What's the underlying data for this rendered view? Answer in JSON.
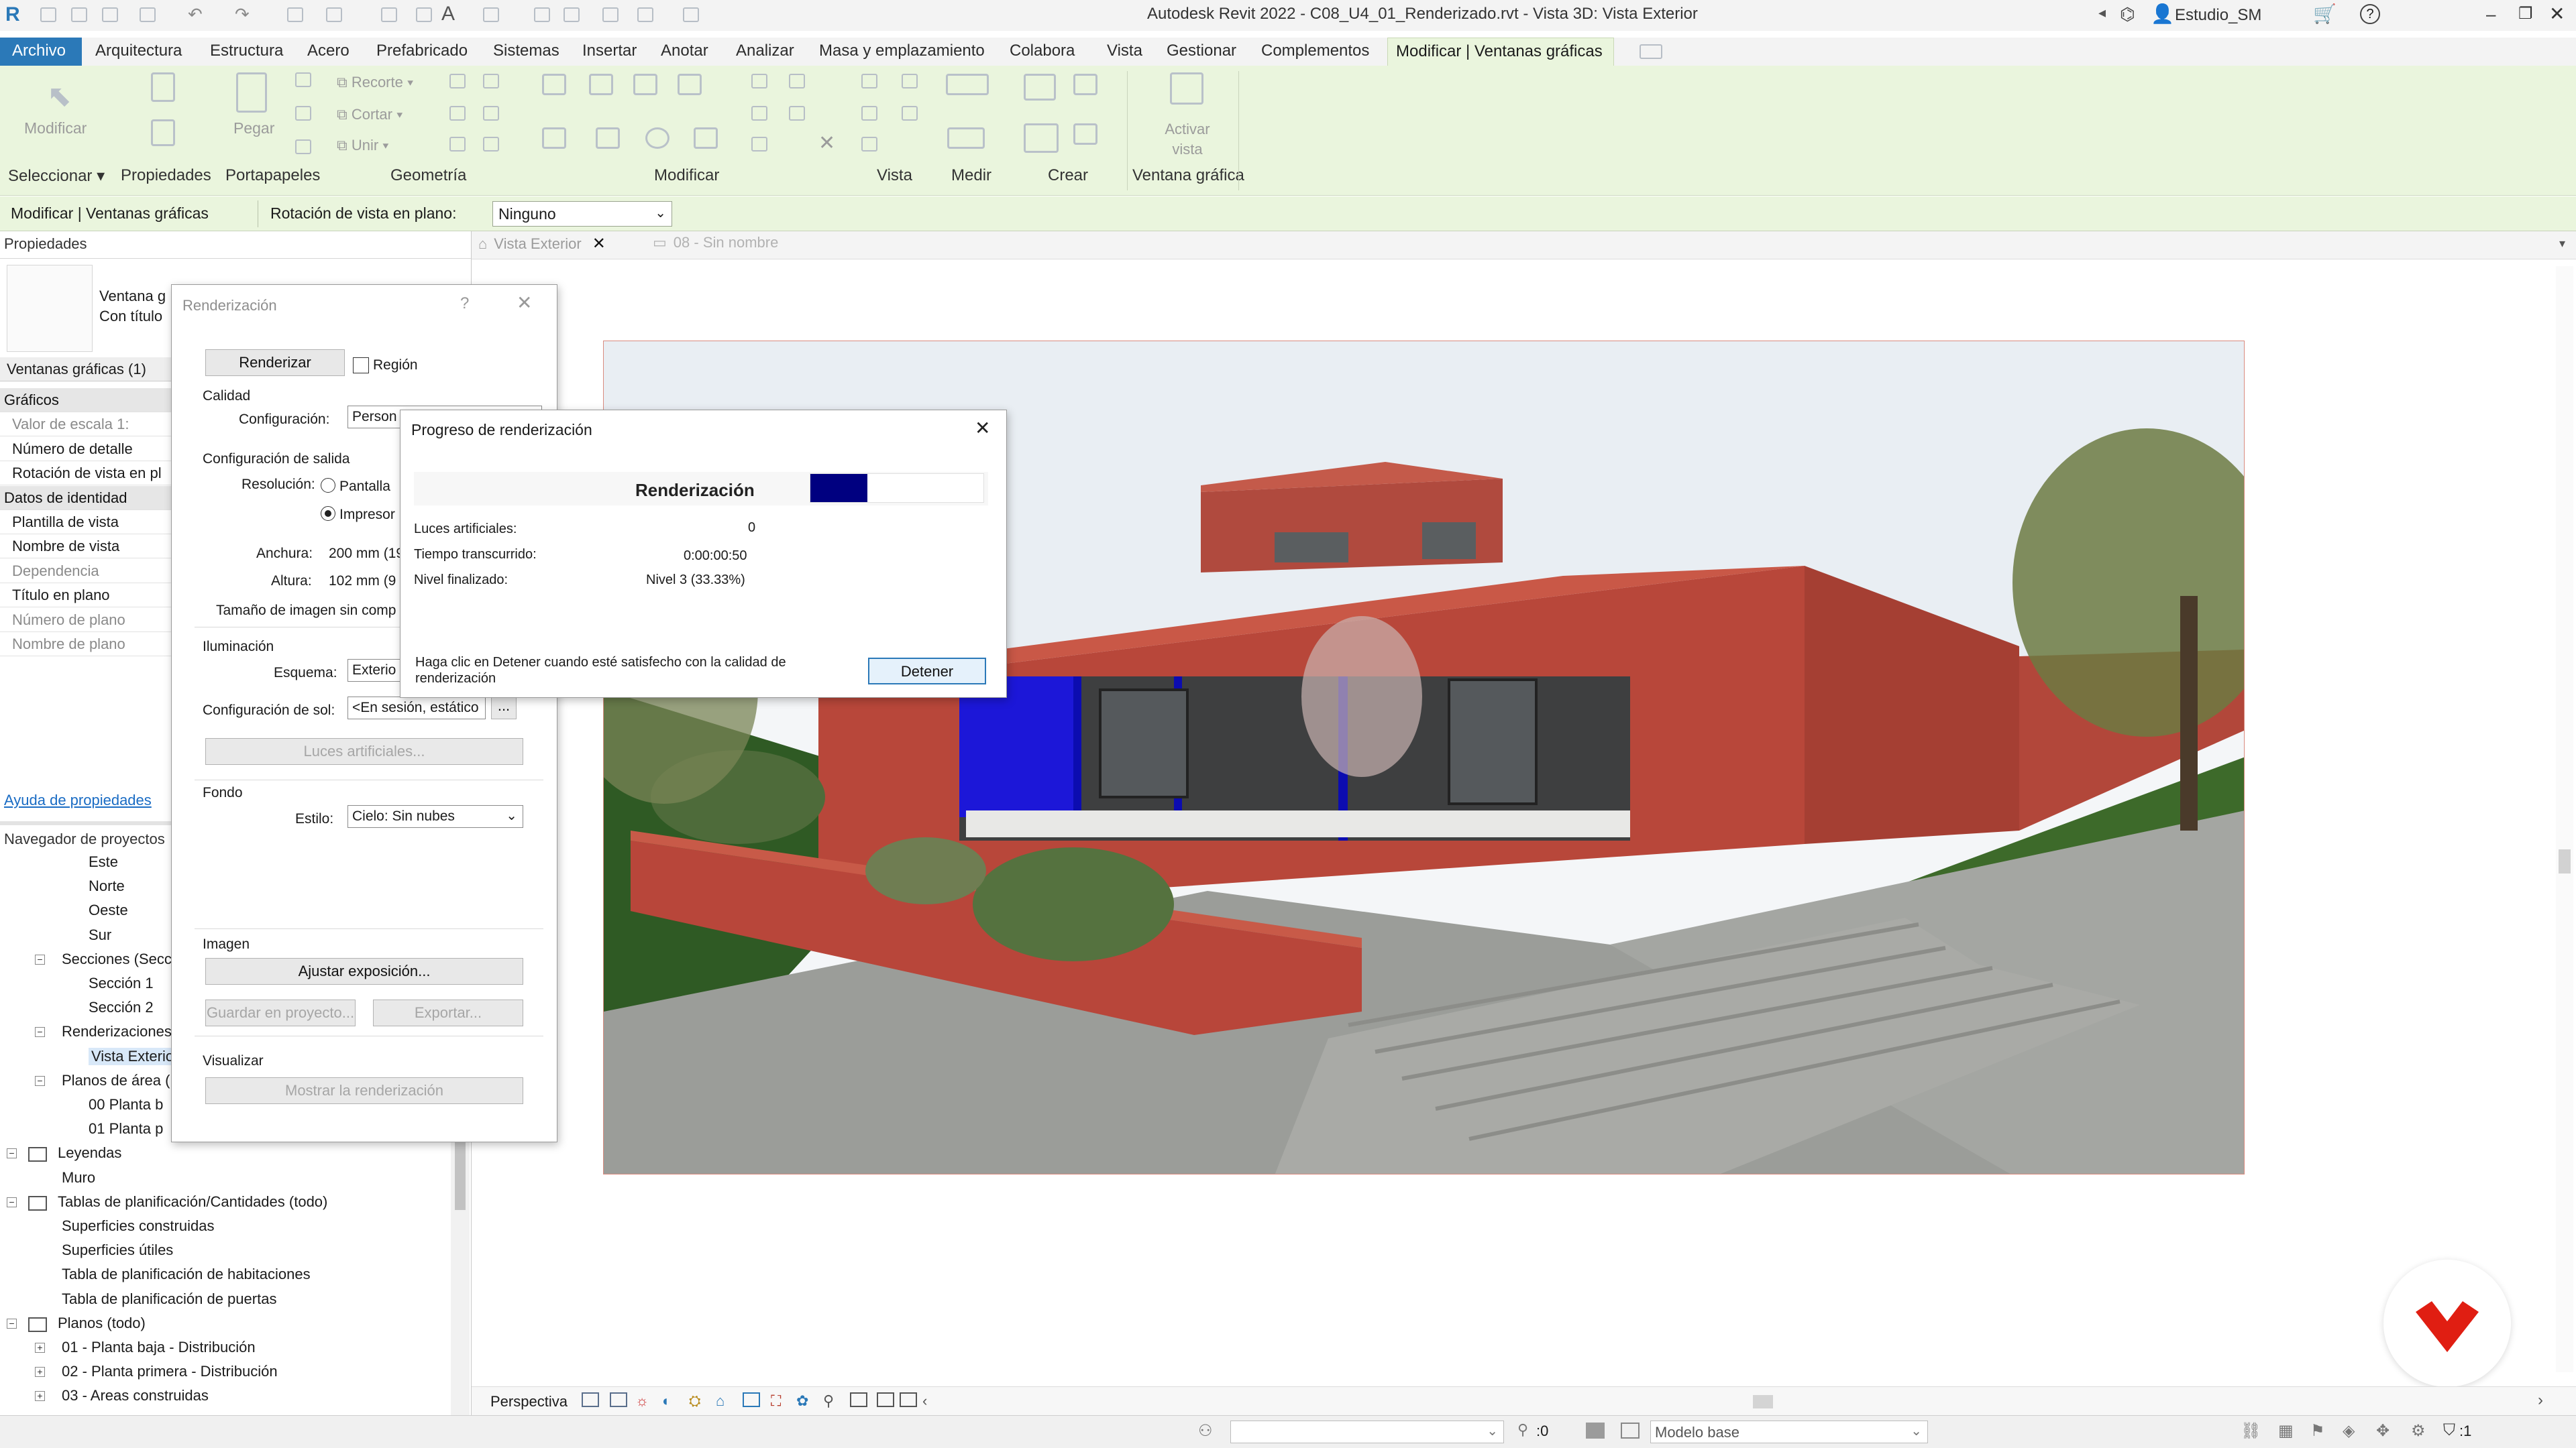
{
  "window": {
    "title": "Autodesk Revit 2022 - C08_U4_01_Renderizado.rvt - Vista 3D: Vista Exterior",
    "user": "Estudio_SM"
  },
  "menu": {
    "items": [
      "Archivo",
      "Arquitectura",
      "Estructura",
      "Acero",
      "Prefabricado",
      "Sistemas",
      "Insertar",
      "Anotar",
      "Analizar",
      "Masa y emplazamiento",
      "Colabora",
      "Vista",
      "Gestionar",
      "Complementos"
    ],
    "context_tab": "Modificar | Ventanas gráficas"
  },
  "ribbon": {
    "modify": "Modificar",
    "paste": "Pegar",
    "cut_copy": "Recorte",
    "cortar": "Cortar",
    "unir": "Unir",
    "activate_view": "Activar vista",
    "groups": {
      "select": "Seleccionar",
      "properties": "Propiedades",
      "clipboard": "Portapapeles",
      "geometry": "Geometría",
      "modify": "Modificar",
      "view": "Vista",
      "measure": "Medir",
      "create": "Crear",
      "viewport": "Ventana gráfica"
    }
  },
  "options_bar": {
    "context": "Modificar | Ventanas gráficas",
    "rotation_label": "Rotación de vista en plano:",
    "rotation_value": "Ninguno"
  },
  "properties": {
    "title": "Propiedades",
    "type_line1": "Ventana g",
    "type_line2": "Con título",
    "selector": "Ventanas gráficas (1)",
    "rows": [
      {
        "label": "Gráficos",
        "header": true
      },
      {
        "label": "Valor de escala    1:",
        "gray": true
      },
      {
        "label": "Número de detalle"
      },
      {
        "label": "Rotación de vista en pl"
      },
      {
        "label": "Datos de identidad",
        "header": true
      },
      {
        "label": "Plantilla de vista"
      },
      {
        "label": "Nombre de vista"
      },
      {
        "label": "Dependencia",
        "gray": true
      },
      {
        "label": "Título en plano"
      },
      {
        "label": "Número de plano",
        "gray": true
      },
      {
        "label": "Nombre de plano",
        "gray": true
      }
    ],
    "help_link": "Ayuda de propiedades"
  },
  "browser": {
    "title": "Navegador de proyectos",
    "items": [
      {
        "label": "Este",
        "indent": 3
      },
      {
        "label": "Norte",
        "indent": 3
      },
      {
        "label": "Oeste",
        "indent": 3
      },
      {
        "label": "Sur",
        "indent": 3
      },
      {
        "label": "Secciones (Secc",
        "indent": 2,
        "toggle": "-"
      },
      {
        "label": "Sección 1",
        "indent": 3
      },
      {
        "label": "Sección 2",
        "indent": 3
      },
      {
        "label": "Renderizaciones",
        "indent": 2,
        "toggle": "-"
      },
      {
        "label": "Vista Exterior",
        "indent": 3,
        "selected": true
      },
      {
        "label": "Planos de área (",
        "indent": 2,
        "toggle": "-"
      },
      {
        "label": "00 Planta b",
        "indent": 3
      },
      {
        "label": "01 Planta p",
        "indent": 3
      },
      {
        "label": "Leyendas",
        "indent": 0,
        "toggle": "-",
        "icon": true
      },
      {
        "label": "Muro",
        "indent": 1
      },
      {
        "label": "Tablas de planificación/Cantidades (todo)",
        "indent": 0,
        "toggle": "-",
        "icon": true
      },
      {
        "label": "Superficies construidas",
        "indent": 1
      },
      {
        "label": "Superficies útiles",
        "indent": 1
      },
      {
        "label": "Tabla de planificación de habitaciones",
        "indent": 1
      },
      {
        "label": "Tabla de planificación de puertas",
        "indent": 1
      },
      {
        "label": "Planos (todo)",
        "indent": 0,
        "toggle": "-",
        "icon": true
      },
      {
        "label": "01 - Planta baja - Distribución",
        "indent": 1,
        "toggle": "+"
      },
      {
        "label": "02 - Planta primera - Distribución",
        "indent": 1,
        "toggle": "+"
      },
      {
        "label": "03 - Areas construidas",
        "indent": 1,
        "toggle": "+"
      }
    ]
  },
  "view_tabs": [
    {
      "label": "Vista Exterior",
      "active": true
    },
    {
      "label": "08 - Sin nombre",
      "active": false
    }
  ],
  "render_dialog": {
    "title": "Renderización",
    "help": "?",
    "render_button": "Renderizar",
    "region_label": "Región",
    "quality_section": "Calidad",
    "config_label": "Configuración:",
    "config_value": "Person",
    "output_section": "Configuración de salida",
    "resolution_label": "Resolución:",
    "res_screen": "Pantalla",
    "res_printer": "Impresor",
    "width_label": "Anchura:",
    "width_value": "200 mm (19",
    "height_label": "Altura:",
    "height_value": "102 mm (9",
    "size_label": "Tamaño de imagen sin comp",
    "lighting_section": "Iluminación",
    "scheme_label": "Esquema:",
    "scheme_value": "Exterio",
    "sun_label": "Configuración de sol:",
    "sun_value": "<En sesión, estático",
    "sun_more": "...",
    "artificial_lights": "Luces artificiales...",
    "bg_section": "Fondo",
    "style_label": "Estilo:",
    "style_value": "Cielo: Sin nubes",
    "image_section": "Imagen",
    "adjust_exposure": "Ajustar exposición...",
    "save_project": "Guardar en proyecto...",
    "export": "Exportar...",
    "display_section": "Visualizar",
    "show_render": "Mostrar la renderización"
  },
  "progress_dialog": {
    "title": "Progreso de renderización",
    "status": "Renderización",
    "progress": 0.33,
    "lights_label": "Luces artificiales:",
    "lights_value": "0",
    "elapsed_label": "Tiempo transcurrido:",
    "elapsed_value": "0:00:00:50",
    "level_label": "Nivel finalizado:",
    "level_value": "Nivel 3 (33.33%)",
    "hint": "Haga clic en Detener cuando esté satisfecho con la calidad de renderización",
    "stop_button": "Detener"
  },
  "view_control": {
    "perspective": "Perspectiva"
  },
  "status_bar": {
    "workset": "",
    "count": ":0",
    "model": "Modelo base",
    "filter": ":1"
  },
  "colors": {
    "ribbon_green": "#eaf5dd",
    "revit_blue": "#2b79b8",
    "progress_fill": "#000080",
    "wall_terracotta": "#b8473a"
  }
}
